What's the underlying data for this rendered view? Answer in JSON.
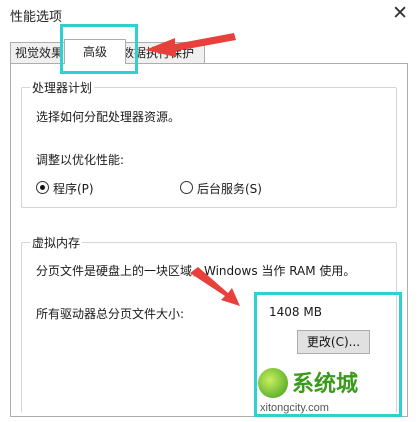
{
  "window": {
    "title": "性能选项",
    "close_icon": "✕"
  },
  "tabs": [
    {
      "label": "视觉效果"
    },
    {
      "label": "高级",
      "selected": true
    },
    {
      "label": "数据执行保护"
    }
  ],
  "processor": {
    "group_title": "处理器计划",
    "description": "选择如何分配处理器资源。",
    "adjust_label": "调整以优化性能:",
    "options": [
      {
        "label": "程序(P)",
        "checked": true
      },
      {
        "label": "后台服务(S)",
        "checked": false
      }
    ]
  },
  "virtual_memory": {
    "group_title": "虚拟内存",
    "description": "分页文件是硬盘上的一块区域，Windows 当作 RAM 使用。",
    "total_label": "所有驱动器总分页文件大小:",
    "total_value": "1408 MB",
    "change_button": "更改(C)..."
  },
  "watermark": {
    "name": "系统城",
    "url": "xitongcity.com"
  },
  "colors": {
    "highlight": "#2fd0cf",
    "arrow": "#e8403a",
    "watermark_green": "#3a9a1a"
  }
}
